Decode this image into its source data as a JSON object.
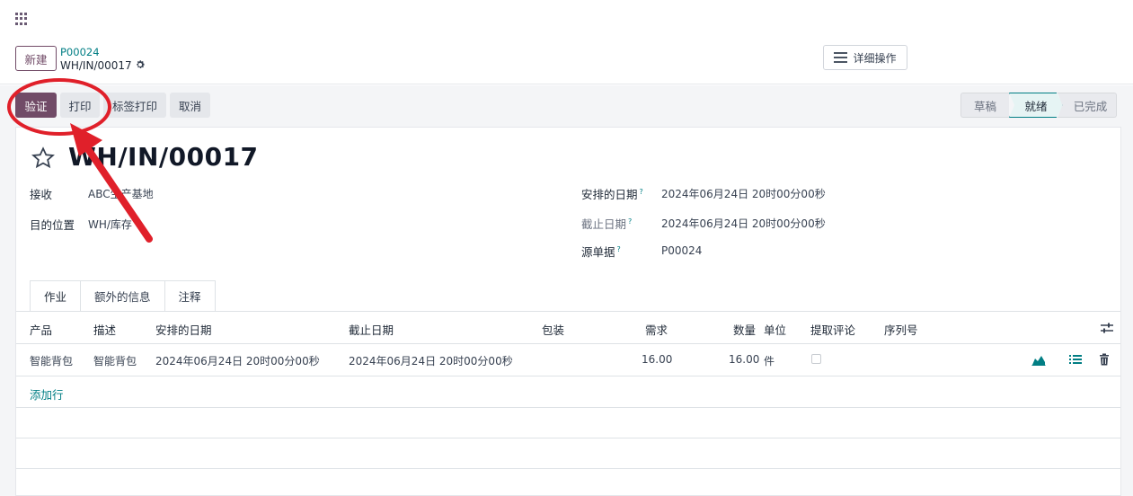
{
  "topbar": {
    "apps_icon": "apps-grid-icon"
  },
  "control_panel": {
    "new_button": "新建",
    "breadcrumb_parent": "P00024",
    "breadcrumb_current": "WH/IN/00017",
    "gear_icon": "gear-icon",
    "actions_button": "详细操作"
  },
  "statusbar": {
    "buttons": {
      "validate": "验证",
      "print": "打印",
      "label_print": "标签打印",
      "cancel": "取消"
    },
    "stages": [
      "草稿",
      "就绪",
      "已完成"
    ],
    "active_stage": "就绪"
  },
  "form": {
    "title": "WH/IN/00017",
    "fields_left": [
      {
        "label": "接收",
        "value": "ABC生产基地"
      },
      {
        "label": "目的位置",
        "value": "WH/库存"
      }
    ],
    "fields_right": [
      {
        "label": "安排的日期",
        "help": "?",
        "value": "2024年06月24日 20时00分00秒"
      },
      {
        "label": "截止日期",
        "help": "?",
        "value": "2024年06月24日 20时00分00秒"
      },
      {
        "label": "源单据",
        "help": "?",
        "value": "P00024"
      }
    ],
    "tabs": [
      "作业",
      "额外的信息",
      "注释"
    ],
    "table": {
      "headers": [
        "产品",
        "描述",
        "安排的日期",
        "截止日期",
        "包装",
        "需求",
        "数量",
        "单位",
        "提取评论",
        "序列号"
      ],
      "rows": [
        {
          "product": "智能背包",
          "description": "智能背包",
          "scheduled": "2024年06月24日 20时00分00秒",
          "deadline": "2024年06月24日 20时00分00秒",
          "packaging": "",
          "demand": "16.00",
          "quantity": "16.00",
          "uom": "件",
          "picked_comment": false,
          "serial": ""
        }
      ],
      "add_line": "添加行"
    }
  },
  "colors": {
    "brand": "#714b67",
    "accent": "#017e84",
    "annotation": "#e0202a"
  }
}
